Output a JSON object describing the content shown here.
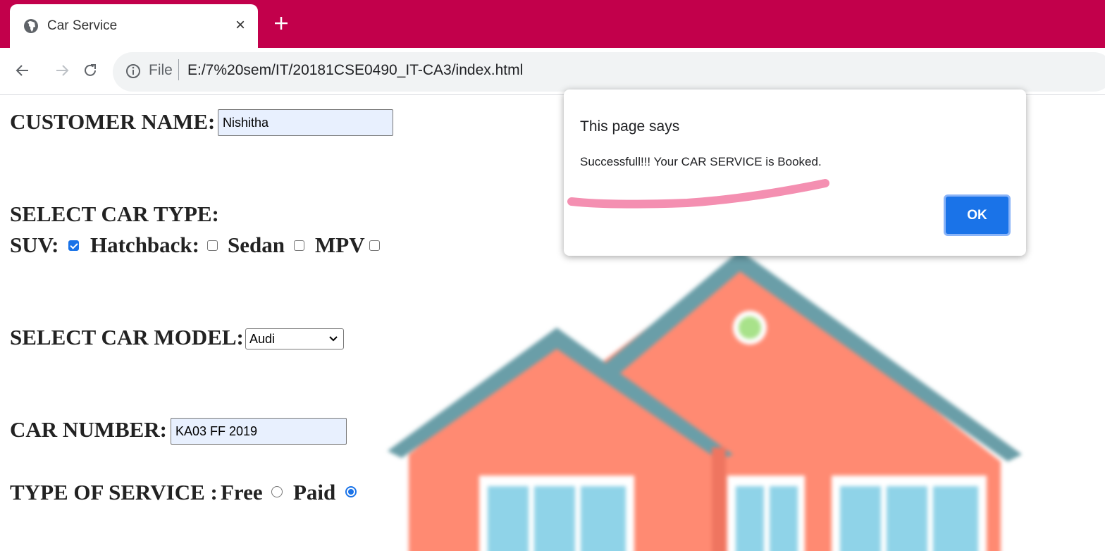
{
  "browser": {
    "tab_title": "Car Service",
    "tab_close": "×",
    "url_scheme_label": "File",
    "url": "E:/7%20sem/IT/20181CSE0490_IT-CA3/index.html"
  },
  "form": {
    "customer_name_label": "CUSTOMER NAME:",
    "customer_name_value": "Nishitha",
    "car_type_label": "SELECT CAR TYPE:",
    "car_types": [
      {
        "label": "SUV:",
        "checked": true
      },
      {
        "label": "Hatchback:",
        "checked": false
      },
      {
        "label": "Sedan",
        "checked": false
      },
      {
        "label": "MPV",
        "checked": false
      }
    ],
    "car_model_label": "SELECT CAR MODEL:",
    "car_model_selected": "Audi",
    "car_number_label": "CAR NUMBER:",
    "car_number_value": "KA03 FF 2019",
    "service_type_label": "TYPE OF SERVICE :",
    "service_types": [
      {
        "label": "Free",
        "selected": false
      },
      {
        "label": "Paid",
        "selected": true
      }
    ]
  },
  "dialog": {
    "title": "This page says",
    "message": "Successfull!!! Your CAR SERVICE is Booked.",
    "ok_label": "OK"
  },
  "colors": {
    "tabbar": "#c2004b",
    "accent": "#1a73e8",
    "highlight_mark": "#f48fb1",
    "house_wall": "#ff8a72",
    "house_roof": "#6a9ea8",
    "house_window": "#8fd3e8"
  }
}
